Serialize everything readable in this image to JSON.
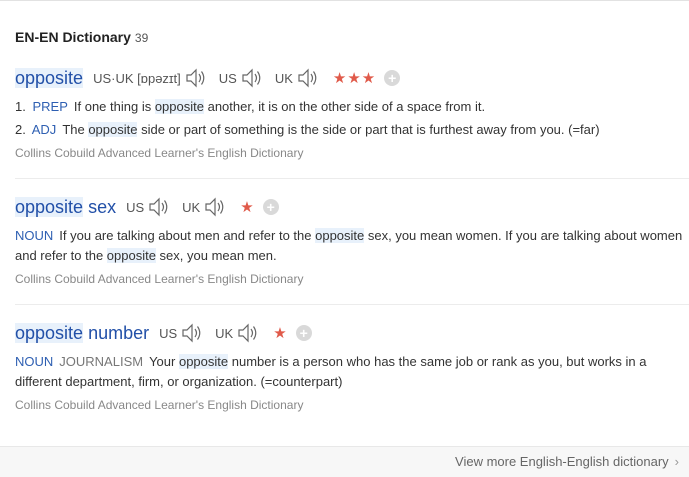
{
  "header": {
    "title": "EN-EN Dictionary",
    "count": "39"
  },
  "entries": [
    {
      "headword": "opposite",
      "headword_rest": "",
      "prons": [
        {
          "label": "US·UK [ɒpəzɪt]"
        },
        {
          "label": "US"
        },
        {
          "label": "UK"
        }
      ],
      "stars": "★★★",
      "senses": [
        {
          "num": "1.",
          "pos": "PREP",
          "before": "If one thing is ",
          "hl": "opposite",
          "after": " another, it is on the other side of a space from it."
        },
        {
          "num": "2.",
          "pos": "ADJ",
          "before": "The ",
          "hl": "opposite",
          "after": " side or part of something is the side or part that is furthest away from you. (=far)"
        }
      ],
      "source": "Collins Cobuild Advanced Learner's English Dictionary"
    },
    {
      "headword": "opposite",
      "headword_rest": " sex",
      "prons": [
        {
          "label": "US"
        },
        {
          "label": "UK"
        }
      ],
      "stars": "★",
      "senses": [
        {
          "pos": "NOUN",
          "t1": "If you are talking about men and refer to the ",
          "hl1": "opposite",
          "t2": " sex, you mean women. If you are talking about women and refer to the ",
          "hl2": "opposite",
          "t3": " sex, you mean men."
        }
      ],
      "source": "Collins Cobuild Advanced Learner's English Dictionary"
    },
    {
      "headword": "opposite",
      "headword_rest": " number",
      "prons": [
        {
          "label": "US"
        },
        {
          "label": "UK"
        }
      ],
      "stars": "★",
      "senses": [
        {
          "pos": "NOUN",
          "field": "JOURNALISM",
          "before": "Your ",
          "hl": "opposite",
          "after": " number is a person who has the same job or rank as you, but works in a different department, firm, or organization. (=counterpart)"
        }
      ],
      "source": "Collins Cobuild Advanced Learner's English Dictionary"
    }
  ],
  "footer": {
    "more_label": "View more English-English dictionary",
    "chevron": "›"
  },
  "colors": {
    "headword": "#2250a8",
    "pos": "#2e5fb2",
    "star": "#e05a4a",
    "highlight": "#e8f1fb"
  }
}
